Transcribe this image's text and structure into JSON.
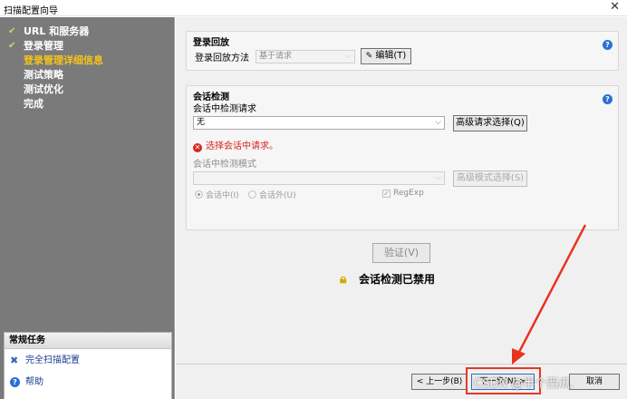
{
  "window": {
    "title": "扫描配置向导",
    "close": "✕"
  },
  "sidebar": {
    "steps": [
      {
        "label": "URL 和服务器",
        "done": true
      },
      {
        "label": "登录管理",
        "done": true
      },
      {
        "label": "登录管理详细信息",
        "current": true
      },
      {
        "label": "测试策略"
      },
      {
        "label": "测试优化"
      },
      {
        "label": "完成"
      }
    ],
    "check_glyph": "✔",
    "tasks": {
      "title": "常规任务",
      "items": [
        {
          "label": "完全扫描配置",
          "icon": "wrench-icon",
          "glyph": "✖"
        },
        {
          "label": "帮助",
          "icon": "help-icon",
          "glyph": "?"
        }
      ]
    }
  },
  "login_replay": {
    "title": "登录回放",
    "method_label": "登录回放方法",
    "method_value": "基于请求",
    "edit_button": "编辑(T)",
    "help": "?"
  },
  "session_detection": {
    "title": "会话检测",
    "request_label": "会话中检测请求",
    "request_value": "无",
    "advanced_request_button": "高级请求选择(Q)",
    "error_text": "选择会话中请求。",
    "pattern_label": "会话中检测模式",
    "pattern_value": "",
    "advanced_pattern_button": "高级模式选择(S)",
    "radio_in_session": "会话中(I)",
    "radio_out_session": "会话外(U)",
    "regexp_label": "RegExp",
    "help": "?"
  },
  "verify_button": "验证(V)",
  "status_text": "会话检测已禁用",
  "nav": {
    "back": "< 上一步(B)",
    "next": "下一步(N) >",
    "cancel": "取消"
  },
  "watermark": "CSDN @半个西瓜.",
  "colors": {
    "sidebar_bg": "#7a7a7a",
    "current_step": "#f5c518",
    "error": "#d8251f",
    "highlight": "#e23a25"
  }
}
